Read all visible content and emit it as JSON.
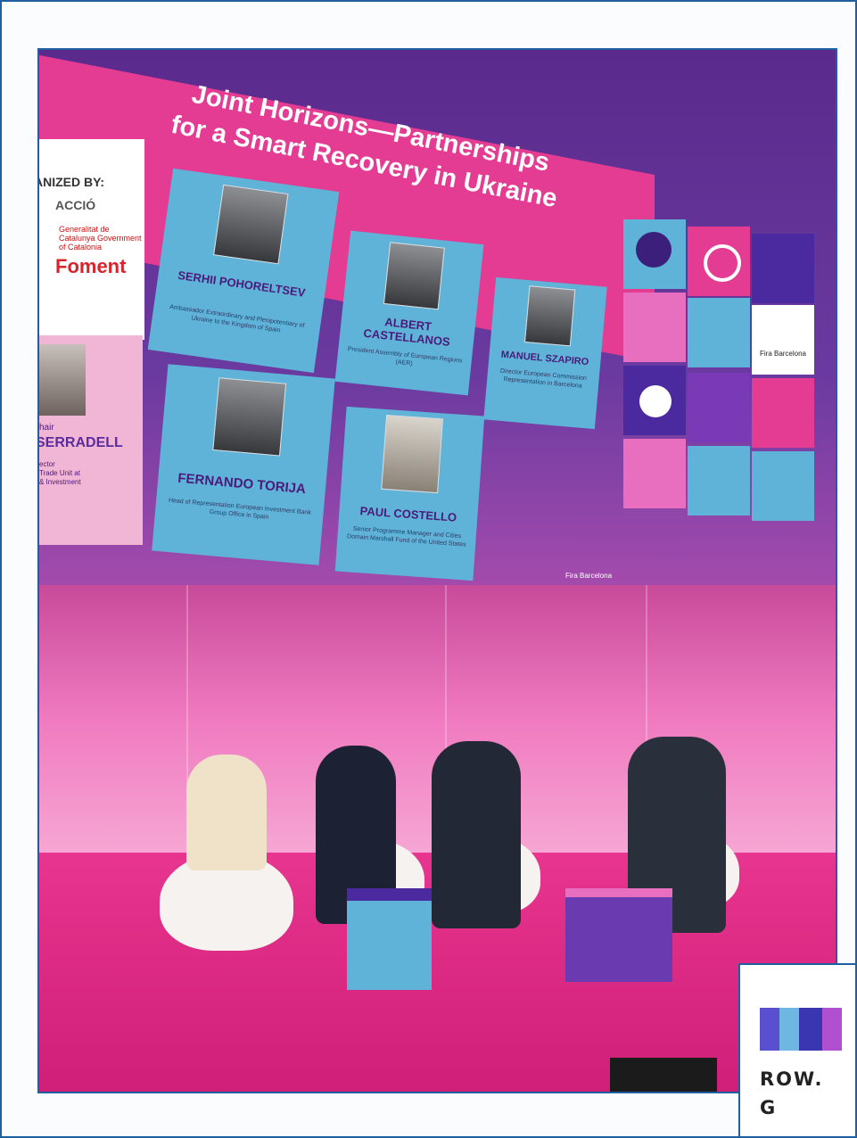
{
  "screen": {
    "title_line1": "Joint Horizons—Partnerships",
    "title_line2": "for a Smart Recovery in Ukraine",
    "organized_by": "ANIZED BY:",
    "org_acció": "ACCIÓ",
    "org_generalitat": "Generalitat de Catalunya Government of Catalonia",
    "org_foment": "Foment",
    "chair_label": "hair",
    "chair_name": "SERRADELL",
    "chair_role": "ector\nTrade Unit at\n& Investment",
    "speakers": [
      {
        "name": "SERHII POHORELTSEV",
        "role": "Ambassador Extraordinary and Plenipotentiary of Ukraine to the Kingdom of Spain"
      },
      {
        "name": "ALBERT CASTELLANOS",
        "role": "President Assembly of European Regions (AER)"
      },
      {
        "name": "MANUEL SZAPIRO",
        "role": "Director European Commission Representation in Barcelona"
      },
      {
        "name": "FERNANDO TORIJA",
        "role": "Head of Representation European Investment Bank Group Office in Spain"
      },
      {
        "name": "PAUL COSTELLO",
        "role": "Senior Programme Manager and Cities Domain Marshall Fund of the United States"
      }
    ],
    "brand": "Fira Barcelona"
  },
  "inset": {
    "line1": "ROW.",
    "line2": "G"
  },
  "colors": {
    "frame": "#1f5fa0",
    "magenta": "#e43b93",
    "purple": "#5a2a8c",
    "card_blue": "#5fb3d9"
  }
}
